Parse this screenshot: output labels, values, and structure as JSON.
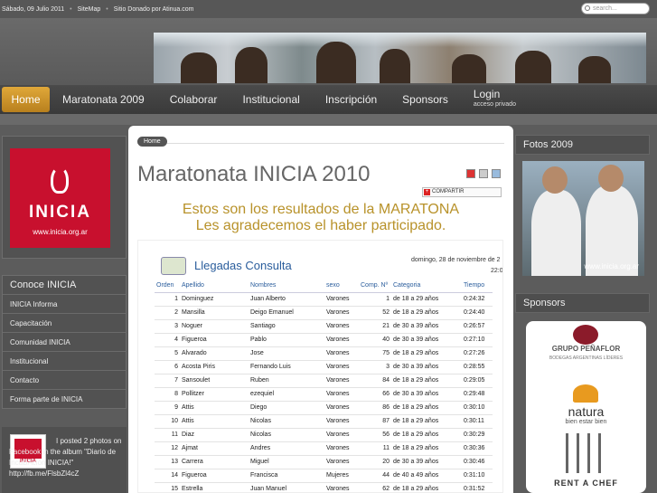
{
  "topbar": {
    "date": "Sábado, 09 Julio 2011",
    "sitemap": "SiteMap",
    "donated": "Sitio Donado por Atinua.com",
    "search_placeholder": "search..."
  },
  "nav": {
    "items": [
      "Home",
      "Maratonata 2009",
      "Colaborar",
      "Institucional",
      "Inscripción",
      "Sponsors"
    ],
    "login": "Login",
    "login_sub": "acceso privado"
  },
  "logo": {
    "name": "INICIA",
    "url": "www.inicia.org.ar"
  },
  "conoce": {
    "title": "Conoce INICIA",
    "items": [
      "INICIA Informa",
      "Capacitación",
      "Comunidad INICIA",
      "Institucional",
      "Contacto",
      "Forma parte de INICIA"
    ]
  },
  "facebook": {
    "thumb_text": "INICIA",
    "text": "I posted 2 photos on Facebook in the album \"Diario de IncuBAción INICIA!\" http://fb.me/FlsbZl4cZ"
  },
  "breadcrumb": "Home",
  "page": {
    "title": "Maratonata INICIA 2010",
    "share": "COMPARTIR",
    "message_1": "Estos son los resultados de la MARATONA",
    "message_2": "Les agradecemos el haber participado."
  },
  "results": {
    "title": "Llegadas Consulta",
    "date": "domingo, 28 de noviembre de 2",
    "time": "22:0",
    "headers": [
      "Orden",
      "Apellido",
      "Nombres",
      "sexo",
      "Comp. Nº",
      "Categoria",
      "Tiempo"
    ],
    "rows": [
      [
        "1",
        "Dominguez",
        "Juan Alberto",
        "Varones",
        "1",
        "de 18 a 29 años",
        "0:24:32"
      ],
      [
        "2",
        "Mansilla",
        "Deigo Emanuel",
        "Varones",
        "52",
        "de 18 a 29 años",
        "0:24:40"
      ],
      [
        "3",
        "Noguer",
        "Santiago",
        "Varones",
        "21",
        "de 30 a 39 años",
        "0:26:57"
      ],
      [
        "4",
        "Figueroa",
        "Pablo",
        "Varones",
        "40",
        "de 30 a 39 años",
        "0:27:10"
      ],
      [
        "5",
        "Alvarado",
        "Jose",
        "Varones",
        "75",
        "de 18 a 29 años",
        "0:27:26"
      ],
      [
        "6",
        "Acosta Piris",
        "Fernando Luis",
        "Varones",
        "3",
        "de 30 a 39 años",
        "0:28:55"
      ],
      [
        "7",
        "Sansoulet",
        "Ruben",
        "Varones",
        "84",
        "de 18 a 29 años",
        "0:29:05"
      ],
      [
        "8",
        "Pollitzer",
        "ezequiel",
        "Varones",
        "66",
        "de 30 a 39 años",
        "0:29:48"
      ],
      [
        "9",
        "Attis",
        "Diego",
        "Varones",
        "86",
        "de 18 a 29 años",
        "0:30:10"
      ],
      [
        "10",
        "Attis",
        "Nicolas",
        "Varones",
        "87",
        "de 18 a 29 años",
        "0:30:11"
      ],
      [
        "11",
        "Diaz",
        "Nicolas",
        "Varones",
        "56",
        "de 18 a 29 años",
        "0:30:29"
      ],
      [
        "12",
        "Ajmat",
        "Andres",
        "Varones",
        "11",
        "de 18 a 29 años",
        "0:30:36"
      ],
      [
        "13",
        "Carrera",
        "Miguel",
        "Varones",
        "20",
        "de 30 a 39 años",
        "0:30:46"
      ],
      [
        "14",
        "Figueroa",
        "Francisca",
        "Mujeres",
        "44",
        "de 40 a 49 años",
        "0:31:10"
      ],
      [
        "15",
        "Estrella",
        "Juan Manuel",
        "Varones",
        "62",
        "de 18 a 29 años",
        "0:31:52"
      ]
    ]
  },
  "right": {
    "photos_title": "Fotos 2009",
    "photo_watermark": "www.inicia.org.ar",
    "sponsors_title": "Sponsors",
    "sponsor_1": "GRUPO PEÑAFLOR",
    "sponsor_1_sub": "BODEGAS ARGENTINAS LÍDERES",
    "sponsor_2": "natura",
    "sponsor_2_sub": "bien estar bien",
    "sponsor_3": "RENT A CHEF"
  }
}
